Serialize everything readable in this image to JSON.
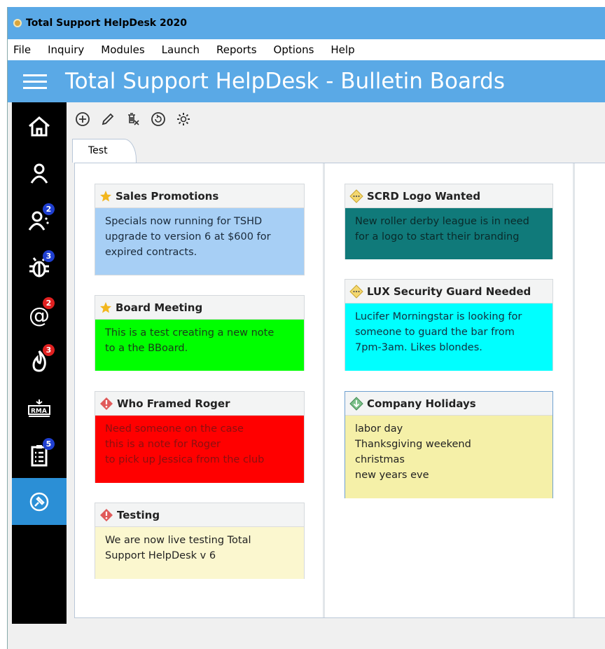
{
  "window": {
    "title": "Total Support HelpDesk 2020"
  },
  "menu": [
    "File",
    "Inquiry",
    "Modules",
    "Launch",
    "Reports",
    "Options",
    "Help"
  ],
  "banner": {
    "title": "Total Support HelpDesk - Bulletin Boards"
  },
  "sidebar": {
    "items": [
      {
        "name": "home-icon",
        "badge": ""
      },
      {
        "name": "user-icon",
        "badge": ""
      },
      {
        "name": "users-icon",
        "badge": "2",
        "badge_color": "#1f3fd1"
      },
      {
        "name": "bug-icon",
        "badge": "3",
        "badge_color": "#1f3fd1"
      },
      {
        "name": "email-icon",
        "badge": "2",
        "badge_color": "#e02020"
      },
      {
        "name": "fire-icon",
        "badge": "3",
        "badge_color": "#e02020"
      },
      {
        "name": "rma-icon",
        "badge": "",
        "label": "RMA"
      },
      {
        "name": "clipboard-icon",
        "badge": "5",
        "badge_color": "#1f3fd1"
      },
      {
        "name": "pin-icon",
        "badge": "",
        "active": true
      }
    ]
  },
  "toolbar": {
    "icons": [
      "add-icon",
      "edit-icon",
      "delete-icon",
      "refresh-icon",
      "settings-icon"
    ]
  },
  "tabs": [
    {
      "label": "Test"
    }
  ],
  "notes": [
    {
      "id": "n1",
      "title": "Sales Promotions",
      "icon": "star-icon",
      "color": "#a7cff5",
      "text_color": "#1a2a3a",
      "lines": [
        "Specials now running for TSHD",
        "upgrade to version 6 at $600 for",
        "expired contracts."
      ]
    },
    {
      "id": "n2",
      "title": "Board Meeting",
      "icon": "star-icon",
      "color": "#00ff00",
      "text_color": "#1a3a1a",
      "lines": [
        "This is a test creating a new note",
        "to a the BBoard."
      ]
    },
    {
      "id": "n3",
      "title": "Who Framed Roger",
      "icon": "alert-icon",
      "color": "#ff0000",
      "text_color": "#8a1010",
      "lines": [
        "Need someone on the case",
        "this is a note for Roger",
        "to pick up Jessica from the club"
      ]
    },
    {
      "id": "n4",
      "title": "Testing",
      "icon": "alert-icon",
      "color": "#fbf7cf",
      "text_color": "#222222",
      "lines": [
        "We are now live testing Total",
        "Support HelpDesk v 6"
      ]
    },
    {
      "id": "n5",
      "title": "SCRD Logo Wanted",
      "icon": "info-icon",
      "color": "#107a7a",
      "text_color": "#0a2a2a",
      "lines": [
        "New roller derby league is in need",
        "for a logo to start their branding"
      ]
    },
    {
      "id": "n6",
      "title": "LUX Security Guard Needed",
      "icon": "info-icon",
      "color": "#00ffff",
      "text_color": "#123040",
      "lines": [
        "Lucifer Morningstar is looking for",
        "someone to guard the bar from",
        "7pm-3am. Likes blondes."
      ]
    },
    {
      "id": "n7",
      "title": "Company Holidays",
      "icon": "down-arrow-icon",
      "color": "#f5f0a8",
      "text_color": "#222222",
      "lines": [
        "labor day",
        "Thanksgiving weekend",
        "christmas",
        "new years eve"
      ]
    }
  ]
}
